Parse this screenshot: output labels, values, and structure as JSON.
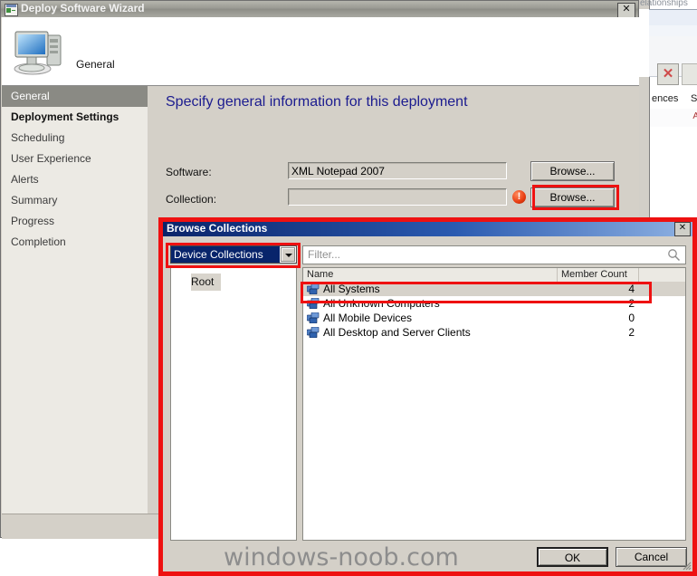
{
  "background_window": {
    "header_text": "elationships",
    "tab_a": "ences",
    "tab_b": "S",
    "column_hint": "A",
    "close_x": "✕",
    "delete_icon": "delete-x-icon"
  },
  "wizard": {
    "title": "Deploy Software Wizard",
    "title_icon": "wizard-window-icon",
    "close_label": "✕",
    "header_title": "General",
    "header_icon": "computer-monitor-icon",
    "sidebar": {
      "items": [
        {
          "label": "General",
          "selected": true,
          "bold": false
        },
        {
          "label": "Deployment Settings",
          "selected": false,
          "bold": true
        },
        {
          "label": "Scheduling",
          "selected": false,
          "bold": false
        },
        {
          "label": "User Experience",
          "selected": false,
          "bold": false
        },
        {
          "label": "Alerts",
          "selected": false,
          "bold": false
        },
        {
          "label": "Summary",
          "selected": false,
          "bold": false
        },
        {
          "label": "Progress",
          "selected": false,
          "bold": false
        },
        {
          "label": "Completion",
          "selected": false,
          "bold": false
        }
      ]
    },
    "content": {
      "heading": "Specify general information for this deployment",
      "software_label": "Software:",
      "software_value": "XML Notepad 2007",
      "software_browse": "Browse...",
      "collection_label": "Collection:",
      "collection_value": "",
      "collection_browse": "Browse...",
      "error_icon": "!",
      "error_icon_name": "validation-error-icon"
    }
  },
  "dialog": {
    "title": "Browse Collections",
    "close_label": "✕",
    "collection_type": "Device Collections",
    "tree_root": "Root",
    "tree_root_icon": "folder-collection-icon",
    "filter_placeholder": "Filter...",
    "search_icon": "search-magnifier-icon",
    "columns": [
      "Name",
      "Member Count"
    ],
    "rows": [
      {
        "name": "All Systems",
        "count": "4",
        "selected": true
      },
      {
        "name": "All Unknown Computers",
        "count": "2",
        "selected": false
      },
      {
        "name": "All Mobile Devices",
        "count": "0",
        "selected": false
      },
      {
        "name": "All Desktop and Server Clients",
        "count": "2",
        "selected": false
      }
    ],
    "ok_label": "OK",
    "cancel_label": "Cancel"
  },
  "watermark": "windows-noob.com",
  "colors": {
    "highlight": "#ee1111",
    "dialog_title": "#0a246a",
    "heading": "#1b1b8f",
    "window_face": "#d4d0c8"
  }
}
